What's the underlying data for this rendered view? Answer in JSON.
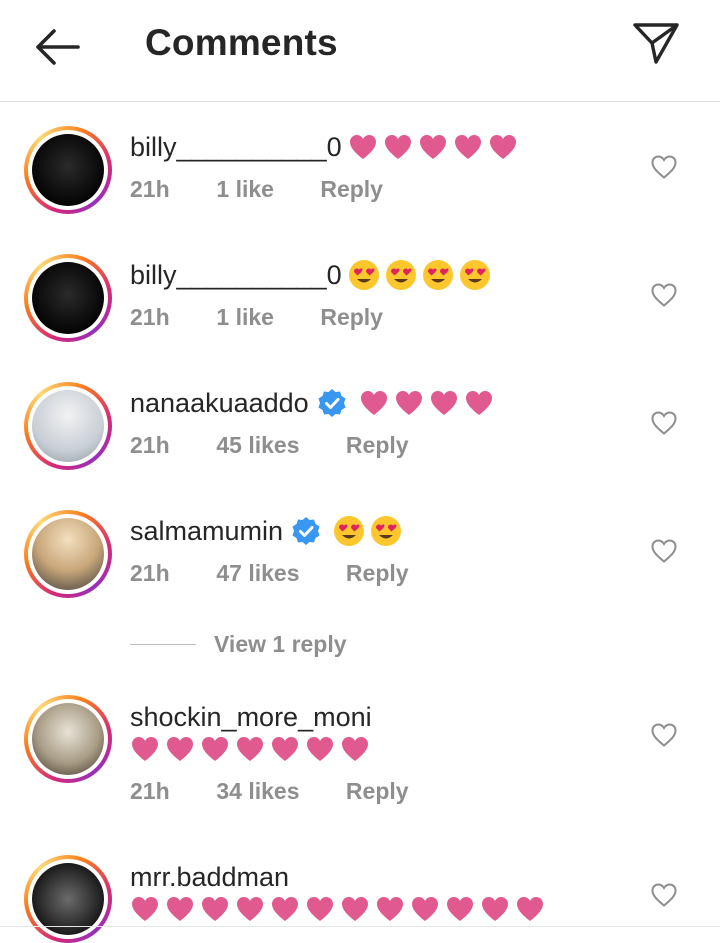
{
  "header": {
    "title": "Comments",
    "back_icon": "arrow-left-icon",
    "send_icon": "paper-plane-icon"
  },
  "colors": {
    "heart": "#e05a8f",
    "verified": "#3897f0",
    "meta": "#8e8e8e",
    "text": "#262626"
  },
  "comments": [
    {
      "username": "billy__________0",
      "verified": false,
      "emoji": "heart",
      "emoji_count": 5,
      "time": "21h",
      "likes": "1 like",
      "reply": "Reply"
    },
    {
      "username": "billy__________0",
      "verified": false,
      "emoji": "smiling-heart-eyes",
      "emoji_count": 4,
      "time": "21h",
      "likes": "1 like",
      "reply": "Reply"
    },
    {
      "username": "nanaakuaaddo",
      "verified": true,
      "emoji": "heart",
      "emoji_count": 4,
      "time": "21h",
      "likes": "45 likes",
      "reply": "Reply"
    },
    {
      "username": "salmamumin",
      "verified": true,
      "emoji": "smiling-heart-eyes",
      "emoji_count": 2,
      "time": "21h",
      "likes": "47 likes",
      "reply": "Reply"
    },
    {
      "username": "shockin_more_moni",
      "verified": false,
      "emoji": "heart",
      "emoji_count": 7,
      "time": "21h",
      "likes": "34 likes",
      "reply": "Reply"
    },
    {
      "username": "mrr.baddman",
      "verified": false,
      "emoji": "heart",
      "emoji_count": 12
    }
  ],
  "view_replies": "View 1 reply"
}
